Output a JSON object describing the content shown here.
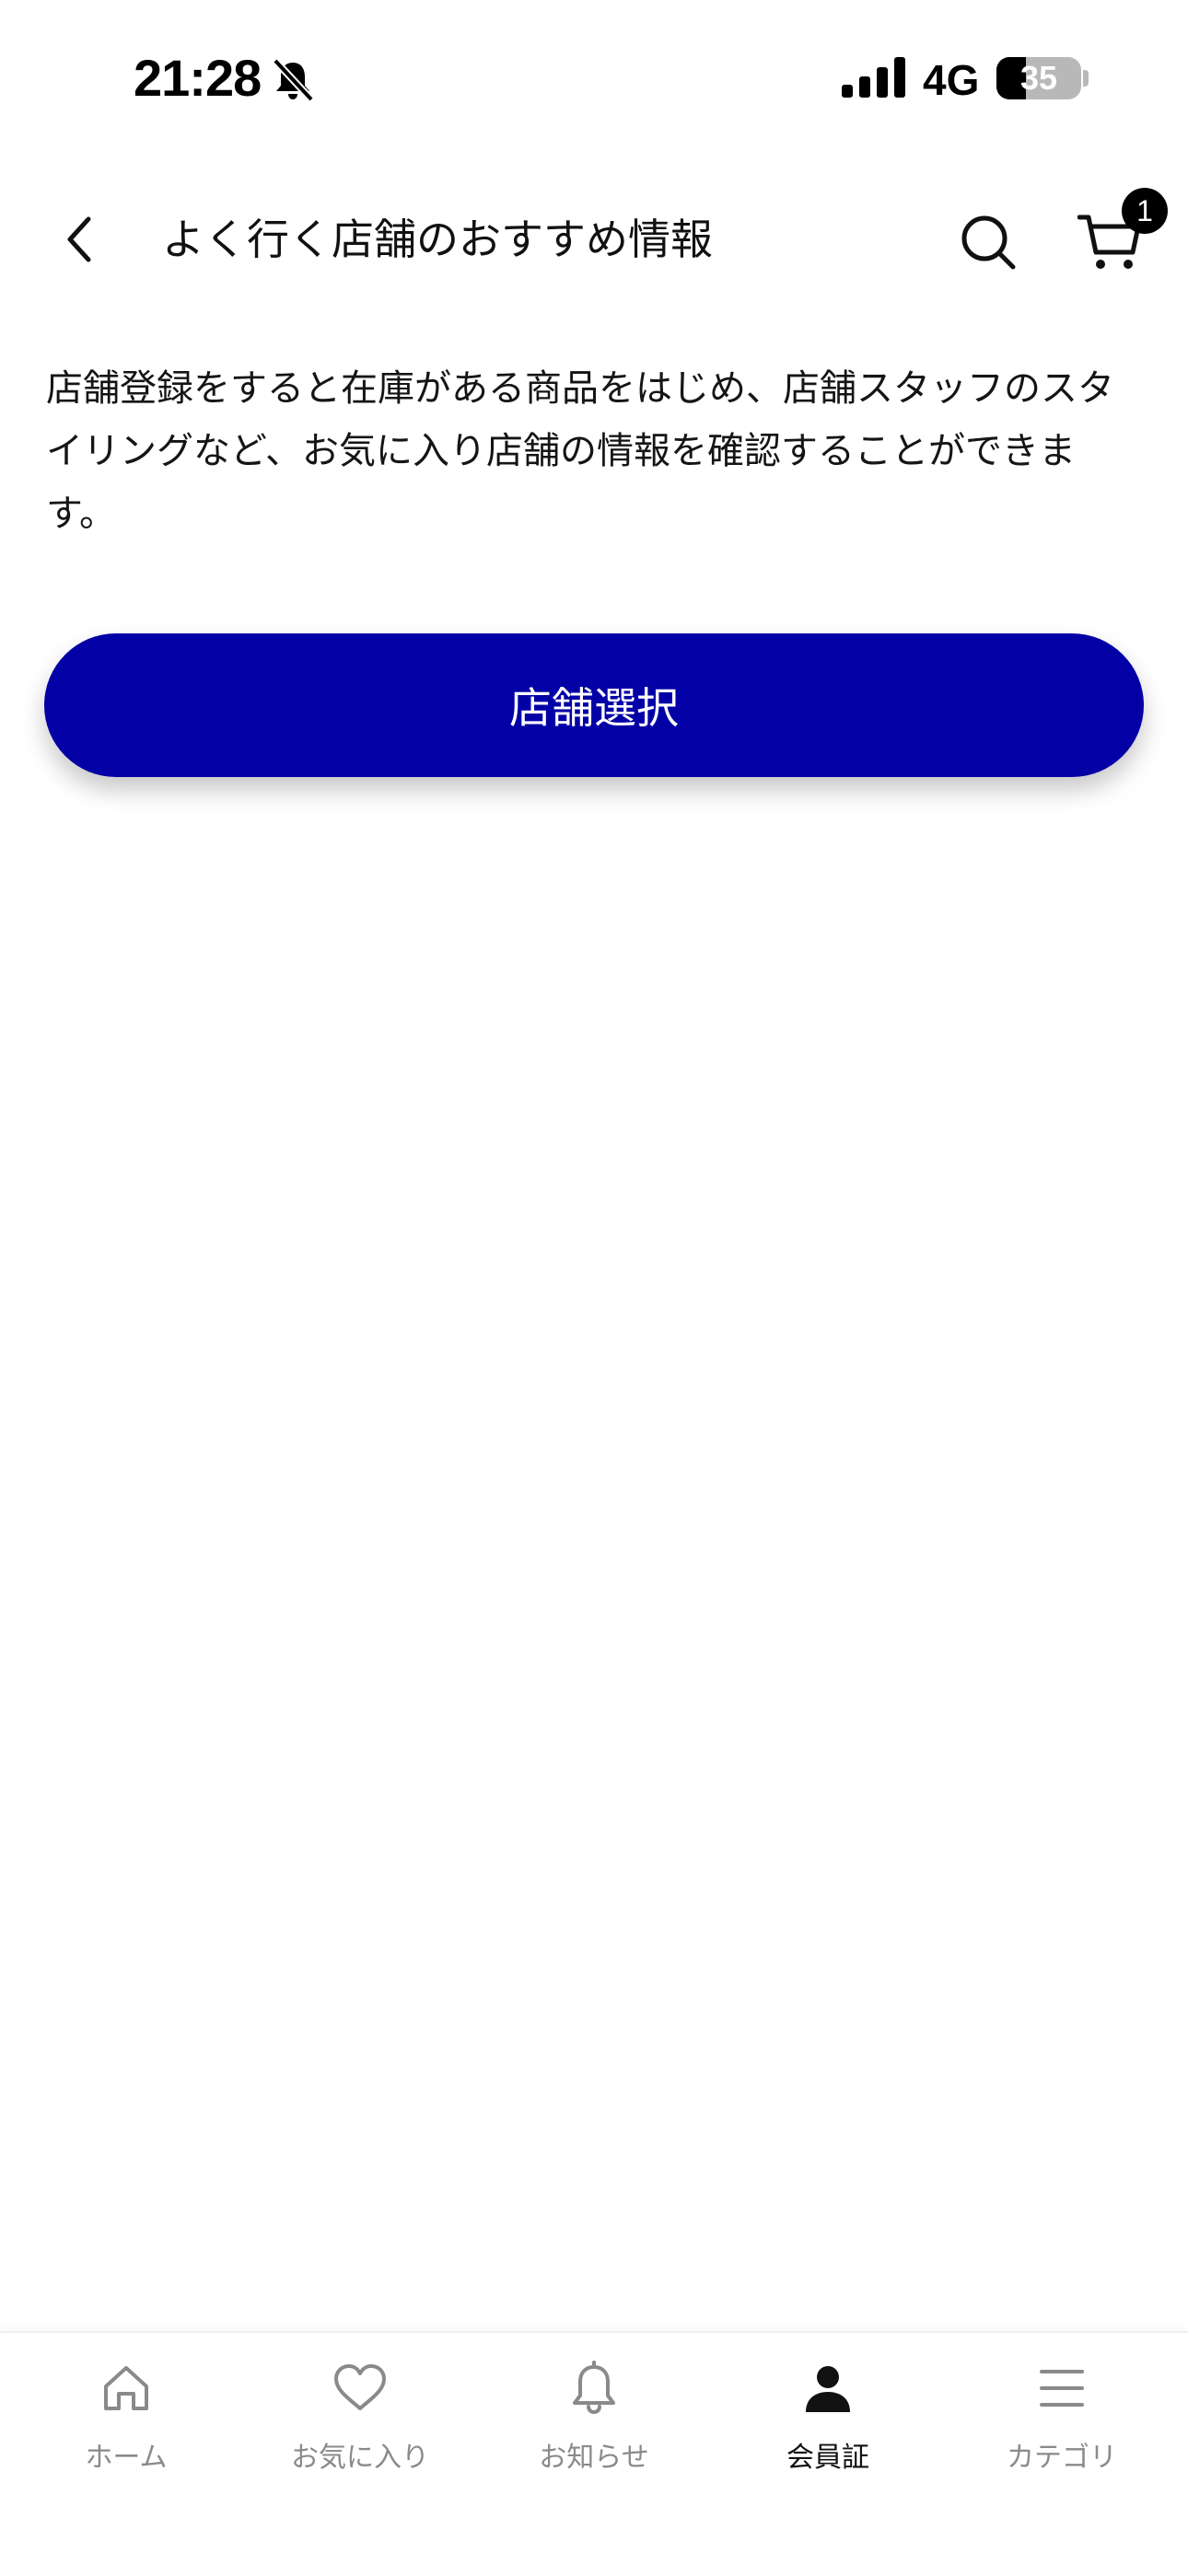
{
  "status_bar": {
    "time": "21:28",
    "network": "4G",
    "battery_level": "35",
    "battery_fraction": 0.35
  },
  "header": {
    "title": "よく行く店舗のおすすめ情報",
    "cart_count": "1",
    "icons": {
      "back": "chevron-left-icon",
      "search": "search-icon",
      "cart": "cart-icon"
    }
  },
  "main": {
    "description": "店舗登録をすると在庫がある商品をはじめ、店舗スタッフのスタイリングなど、お気に入り店舗の情報を確認することができます。",
    "select_store_label": "店舗選択",
    "button_color": "#0300a6"
  },
  "tab_bar": {
    "items": [
      {
        "label": "ホーム",
        "icon": "home-icon",
        "active": false
      },
      {
        "label": "お気に入り",
        "icon": "heart-icon",
        "active": false
      },
      {
        "label": "お知らせ",
        "icon": "bell-icon",
        "active": false
      },
      {
        "label": "会員証",
        "icon": "user-icon",
        "active": true
      },
      {
        "label": "カテゴリ",
        "icon": "menu-icon",
        "active": false
      }
    ]
  }
}
